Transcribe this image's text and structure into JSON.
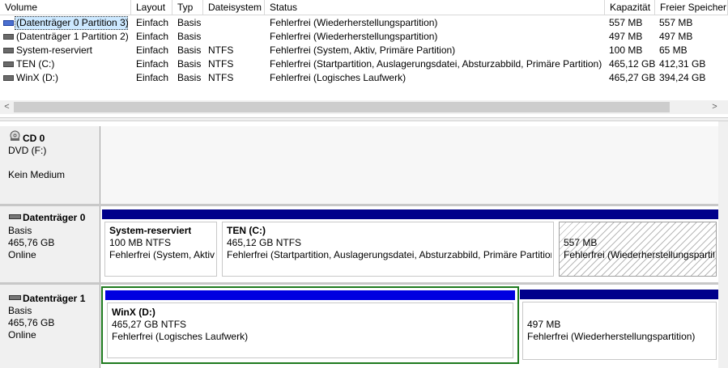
{
  "columns": [
    "Volume",
    "Layout",
    "Typ",
    "Dateisystem",
    "Status",
    "Kapazität",
    "Freier Speicher"
  ],
  "volumes": [
    {
      "name": "(Datenträger 0 Partition 3)",
      "layout": "Einfach",
      "type": "Basis",
      "fs": "",
      "status": "Fehlerfrei (Wiederherstellungspartition)",
      "capacity": "557 MB",
      "free": "557 MB"
    },
    {
      "name": "(Datenträger 1 Partition 2)",
      "layout": "Einfach",
      "type": "Basis",
      "fs": "",
      "status": "Fehlerfrei (Wiederherstellungspartition)",
      "capacity": "497 MB",
      "free": "497 MB"
    },
    {
      "name": "System-reserviert",
      "layout": "Einfach",
      "type": "Basis",
      "fs": "NTFS",
      "status": "Fehlerfrei (System, Aktiv, Primäre Partition)",
      "capacity": "100 MB",
      "free": "65 MB"
    },
    {
      "name": "TEN (C:)",
      "layout": "Einfach",
      "type": "Basis",
      "fs": "NTFS",
      "status": "Fehlerfrei (Startpartition, Auslagerungsdatei, Absturzabbild, Primäre Partition)",
      "capacity": "465,12 GB",
      "free": "412,31 GB"
    },
    {
      "name": "WinX (D:)",
      "layout": "Einfach",
      "type": "Basis",
      "fs": "NTFS",
      "status": "Fehlerfrei (Logisches Laufwerk)",
      "capacity": "465,27 GB",
      "free": "394,24 GB"
    }
  ],
  "scroll": {
    "left_arrow": "<",
    "right_arrow": ">"
  },
  "disks": {
    "cd0": {
      "title": "CD 0",
      "line1": "DVD (F:)",
      "line2": "Kein Medium"
    },
    "disk0": {
      "title": "Datenträger 0",
      "type": "Basis",
      "size": "465,76 GB",
      "state": "Online",
      "partitions": [
        {
          "name": "System-reserviert",
          "size": "100 MB NTFS",
          "status": "Fehlerfrei (System, Aktiv, Primäre Partition)"
        },
        {
          "name": "TEN  (C:)",
          "size": "465,12 GB NTFS",
          "status": "Fehlerfrei (Startpartition, Auslagerungsdatei, Absturzabbild, Primäre Partition)"
        },
        {
          "name": "",
          "size": "557 MB",
          "status": "Fehlerfrei (Wiederherstellungspartition)"
        }
      ]
    },
    "disk1": {
      "title": "Datenträger 1",
      "type": "Basis",
      "size": "465,76 GB",
      "state": "Online",
      "partitions": [
        {
          "name": "WinX  (D:)",
          "size": "465,27 GB NTFS",
          "status": "Fehlerfrei (Logisches Laufwerk)"
        },
        {
          "name": "",
          "size": "497 MB",
          "status": "Fehlerfrei (Wiederherstellungspartition)"
        }
      ]
    }
  }
}
